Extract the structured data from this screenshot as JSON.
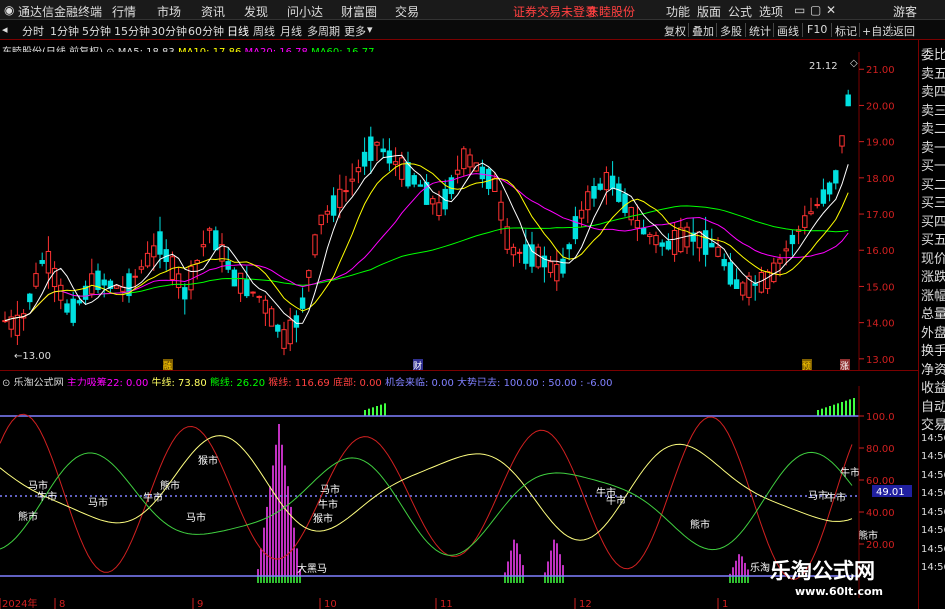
{
  "menubar": {
    "app_title": "通达信金融终端",
    "items": [
      "行情",
      "市场",
      "资讯",
      "发现",
      "问小达",
      "财富圈",
      "交易"
    ],
    "alert": "证券交易未登录",
    "stock_name": "东睦股份",
    "right_items": [
      "功能",
      "版面",
      "公式",
      "选项"
    ],
    "guest": "游客"
  },
  "toolbar": {
    "periods": [
      "分时",
      "1分钟",
      "5分钟",
      "15分钟",
      "30分钟",
      "60分钟",
      "日线",
      "周线",
      "月线",
      "多周期",
      "更多"
    ],
    "active_period": "日线",
    "tools": [
      "复权",
      "叠加",
      "多股",
      "统计",
      "画线",
      "F10",
      "标记",
      "+自选",
      "返回"
    ]
  },
  "main_info": {
    "title": "东睦股份(日线 前复权)",
    "ma5": "MA5: 18.83",
    "ma10": "MA10: 17.86",
    "ma20": "MA20: 16.78",
    "ma60": "MA60: 16.77",
    "high_label": "21.12",
    "low_label": "13.00",
    "events": [
      "融",
      "财",
      "预",
      "涨"
    ]
  },
  "sub_info": {
    "name": "乐淘公式网",
    "zhuli": "主力吸筹22: 0.00",
    "niu": "牛线: 73.80",
    "xiong": "熊线: 26.20",
    "hou": "猴线: 116.69",
    "dibu": "底部: 0.00",
    "jihui": "机会来临: 0.00",
    "dajiao": "大势已去: 100.00 : 50.00 : -6.00",
    "current": "49.01",
    "labels": [
      "马市",
      "牛市",
      "熊市",
      "猴市",
      "大黑马",
      "乐淘"
    ]
  },
  "price_axis": [
    "21.00",
    "20.00",
    "19.00",
    "18.00",
    "17.00",
    "16.00",
    "15.00",
    "14.00",
    "13.00"
  ],
  "sub_axis": [
    "100.0",
    "80.00",
    "60.00",
    "40.00",
    "20.00"
  ],
  "date_axis": [
    "2024年",
    "8",
    "9",
    "10",
    "11",
    "12",
    "1"
  ],
  "side_panel": [
    "委比",
    "卖五",
    "卖四",
    "卖三",
    "卖二",
    "卖一",
    "买一",
    "买二",
    "买三",
    "买四",
    "买五",
    "现价",
    "涨跌",
    "涨幅",
    "总量",
    "外盘",
    "换手",
    "净资",
    "收益",
    "自动",
    "交易",
    "14:56",
    "14:56",
    "14:56",
    "14:56",
    "14:56",
    "14:56",
    "14:56",
    "14:56"
  ],
  "watermark": {
    "title": "乐淘公式网",
    "url": "www.60lt.com"
  },
  "colors": {
    "up": "#ff3232",
    "down": "#00e0e0",
    "ma5": "#ffffff",
    "ma10": "#ffff00",
    "ma20": "#ff00ff",
    "ma60": "#00ff00",
    "baseline": "#8080ff"
  }
}
